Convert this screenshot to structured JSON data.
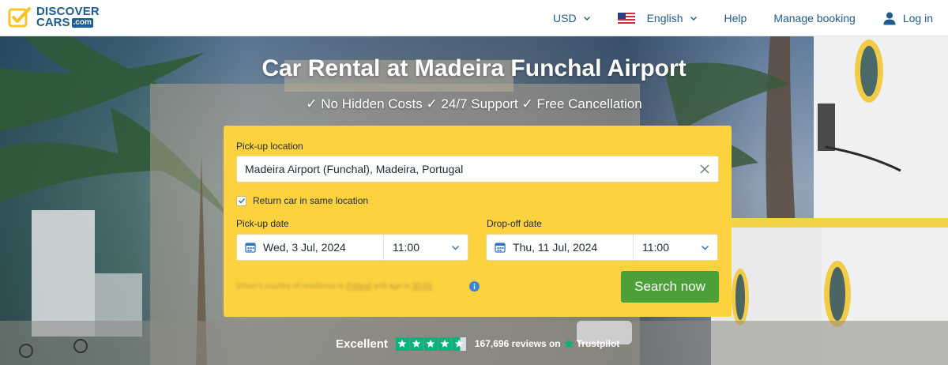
{
  "header": {
    "logo": {
      "line1": "DISCOVER",
      "line2": "CARS",
      "dotcom": ".com"
    },
    "nav": {
      "currency": "USD",
      "language": "English",
      "help": "Help",
      "manage_booking": "Manage booking",
      "login": "Log in"
    }
  },
  "hero": {
    "title": "Car Rental at Madeira Funchal Airport",
    "subtitle": "✓ No Hidden Costs ✓ 24/7 Support ✓ Free Cancellation"
  },
  "form": {
    "pickup_location_label": "Pick-up location",
    "pickup_location_value": "Madeira Airport (Funchal), Madeira, Portugal",
    "return_same_location_label": "Return car in same location",
    "return_same_location_checked": true,
    "pickup_date_label": "Pick-up date",
    "pickup_date": "Wed, 3 Jul, 2024",
    "pickup_time": "11:00",
    "dropoff_date_label": "Drop-off date",
    "dropoff_date": "Thu, 11 Jul, 2024",
    "dropoff_time": "11:00",
    "residence_prefix": "Driver's country of residence is",
    "residence_country": "Poland",
    "residence_mid": "and age is",
    "residence_age": "30-65",
    "search_button": "Search now"
  },
  "trustpilot": {
    "rating_word": "Excellent",
    "stars": 4.5,
    "review_count": "167,696 reviews on",
    "brand": "Trustpilot"
  },
  "colors": {
    "brand_blue": "#1a5d96",
    "form_yellow": "#fdd23f",
    "search_green": "#4ba03a",
    "trustpilot_green": "#00b67a",
    "logo_yellow": "#f7c325"
  }
}
